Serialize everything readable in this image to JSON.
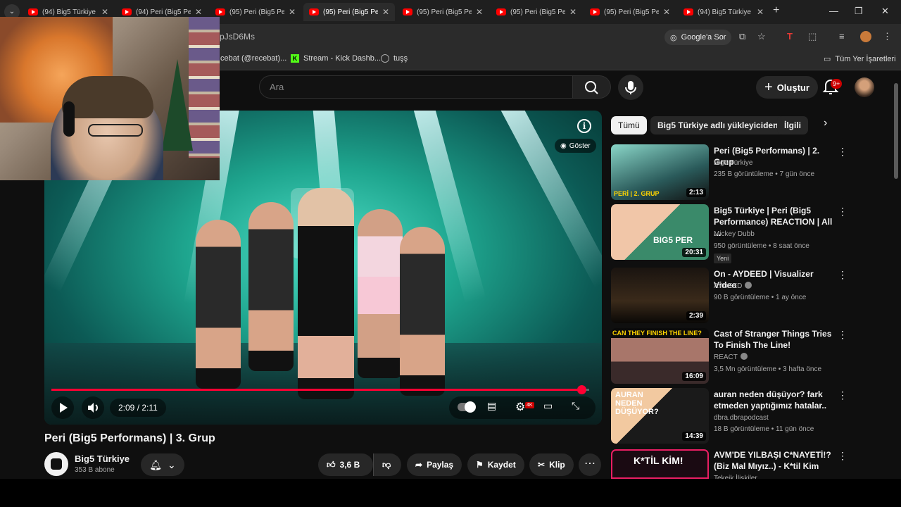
{
  "tabs": [
    {
      "title": "(94) Big5 Türkiye"
    },
    {
      "title": "(94) Peri (Big5 Pe"
    },
    {
      "title": "(95) Peri (Big5 Pe"
    },
    {
      "title": "(95) Peri (Big5 Pe",
      "active": true
    },
    {
      "title": "(95) Peri (Big5 Pe"
    },
    {
      "title": "(95) Peri (Big5 Pe"
    },
    {
      "title": "(95) Peri (Big5 Pe"
    },
    {
      "title": "(94) Big5 Türkiye"
    }
  ],
  "address": {
    "url_fragment": "pJsD6Ms",
    "google_lens": "Google'a Sor"
  },
  "bookmarks": [
    {
      "label": "cebat (@recebat)..."
    },
    {
      "label": "Stream - Kick Dashb..."
    },
    {
      "label": "tuşş"
    }
  ],
  "bookmarks_all": "Tüm Yer İşaretleri",
  "header": {
    "search_placeholder": "Ara",
    "create_label": "Oluştur",
    "notif_badge": "9+"
  },
  "video": {
    "show_label": "Göster",
    "time": "2:09 / 2:11",
    "progress": 0.985,
    "hd_badge": "4K",
    "title": "Peri (Big5 Performans) | 3. Grup",
    "channel": "Big5 Türkiye",
    "subscribers": "353 B abone",
    "likes": "3,6 B",
    "share_label": "Paylaş",
    "save_label": "Kaydet",
    "clip_label": "Klip"
  },
  "chips": [
    "Tümü",
    "Big5 Türkiye adlı yükleyiciden",
    "İlgili"
  ],
  "recommendations": [
    {
      "title": "Peri (Big5 Performans) | 2. Grup",
      "channel": "Big5 Türkiye",
      "meta": "235 B görüntüleme • 7 gün önce",
      "duration": "2:13",
      "thumb_overlay": "PERİ | 2. GRUP"
    },
    {
      "title": "Big5 Türkiye | Peri (Big5 Performance) REACTION | All ...",
      "channel": "Mickey Dubb",
      "meta": "950 görüntüleme • 8 saat önce",
      "duration": "20:31",
      "badge": "Yeni",
      "thumb_overlay": "BIG5 PER"
    },
    {
      "title": "On - AYDEED | Visualizer Video",
      "channel": "AYDEED",
      "meta": "90 B görüntüleme • 1 ay önce",
      "duration": "2:39"
    },
    {
      "title": "Cast of Stranger Things Tries To Finish The Line!",
      "channel": "REACT",
      "meta": "3,5 Mn görüntüleme • 3 hafta önce",
      "duration": "16:09",
      "thumb_overlay": "CAN THEY FINISH THE LINE?"
    },
    {
      "title": "auran neden düşüyor? fark etmeden yaptığımız hatalar..",
      "channel": "dbra.dbrapodcast",
      "meta": "18 B görüntüleme • 11 gün önce",
      "duration": "14:39",
      "thumb_overlay": "AURAN NEDEN DÜŞÜYOR?"
    },
    {
      "title": "AVM'DE YILBAŞI C*NAYETİ!? (Biz Mal Mıyız..) - K*til Kim",
      "channel": "Tekeik İlişkiler",
      "meta": "",
      "duration": "",
      "thumb_overlay": "K*TİL KİM!"
    }
  ]
}
